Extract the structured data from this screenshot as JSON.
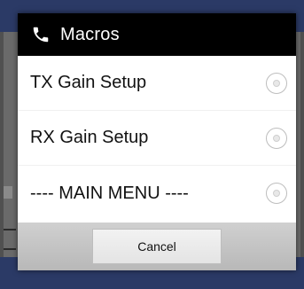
{
  "dialog": {
    "title": "Macros",
    "title_icon": "phone-icon",
    "items": [
      {
        "label": "TX Gain Setup",
        "selected": false
      },
      {
        "label": "RX Gain Setup",
        "selected": false
      },
      {
        "label": "---- MAIN MENU ----",
        "selected": false
      }
    ],
    "cancel_label": "Cancel"
  },
  "colors": {
    "header_bg": "#000000",
    "dialog_bg": "#ffffff",
    "footer_bg": "#c4c4c4",
    "backdrop": "#505050",
    "app_accent": "#2b3a66"
  }
}
